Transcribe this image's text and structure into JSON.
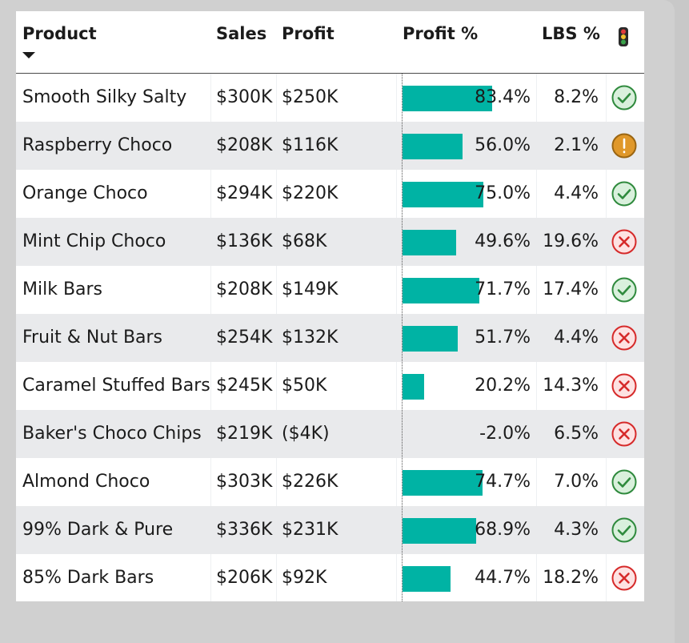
{
  "header": {
    "product": "Product",
    "sales": "Sales",
    "profit": "Profit",
    "profit_pct": "Profit %",
    "lbs_pct": "LBS %",
    "status_icon": "traffic-light-icon"
  },
  "colors": {
    "bar": "#00b3a4",
    "ok": "#3aa34a",
    "warn": "#e0982a",
    "bad": "#e23b3b",
    "alt_row": "#e9eaec"
  },
  "rows": [
    {
      "product": "Smooth Silky Salty",
      "sales": "$300K",
      "profit": "$250K",
      "profit_pct_label": "83.4%",
      "profit_pct": 83.4,
      "lbs_pct": "8.2%",
      "status": "ok"
    },
    {
      "product": "Raspberry Choco",
      "sales": "$208K",
      "profit": "$116K",
      "profit_pct_label": "56.0%",
      "profit_pct": 56.0,
      "lbs_pct": "2.1%",
      "status": "warn"
    },
    {
      "product": "Orange Choco",
      "sales": "$294K",
      "profit": "$220K",
      "profit_pct_label": "75.0%",
      "profit_pct": 75.0,
      "lbs_pct": "4.4%",
      "status": "ok"
    },
    {
      "product": "Mint Chip Choco",
      "sales": "$136K",
      "profit": "$68K",
      "profit_pct_label": "49.6%",
      "profit_pct": 49.6,
      "lbs_pct": "19.6%",
      "status": "bad"
    },
    {
      "product": "Milk Bars",
      "sales": "$208K",
      "profit": "$149K",
      "profit_pct_label": "71.7%",
      "profit_pct": 71.7,
      "lbs_pct": "17.4%",
      "status": "ok"
    },
    {
      "product": "Fruit & Nut Bars",
      "sales": "$254K",
      "profit": "$132K",
      "profit_pct_label": "51.7%",
      "profit_pct": 51.7,
      "lbs_pct": "4.4%",
      "status": "bad"
    },
    {
      "product": "Caramel Stuffed Bars",
      "sales": "$245K",
      "profit": "$50K",
      "profit_pct_label": "20.2%",
      "profit_pct": 20.2,
      "lbs_pct": "14.3%",
      "status": "bad"
    },
    {
      "product": "Baker's Choco Chips",
      "sales": "$219K",
      "profit": "($4K)",
      "profit_pct_label": "-2.0%",
      "profit_pct": -2.0,
      "lbs_pct": "6.5%",
      "status": "bad"
    },
    {
      "product": "Almond Choco",
      "sales": "$303K",
      "profit": "$226K",
      "profit_pct_label": "74.7%",
      "profit_pct": 74.7,
      "lbs_pct": "7.0%",
      "status": "ok"
    },
    {
      "product": "99% Dark & Pure",
      "sales": "$336K",
      "profit": "$231K",
      "profit_pct_label": "68.9%",
      "profit_pct": 68.9,
      "lbs_pct": "4.3%",
      "status": "ok"
    },
    {
      "product": "85% Dark Bars",
      "sales": "$206K",
      "profit": "$92K",
      "profit_pct_label": "44.7%",
      "profit_pct": 44.7,
      "lbs_pct": "18.2%",
      "status": "bad"
    }
  ]
}
